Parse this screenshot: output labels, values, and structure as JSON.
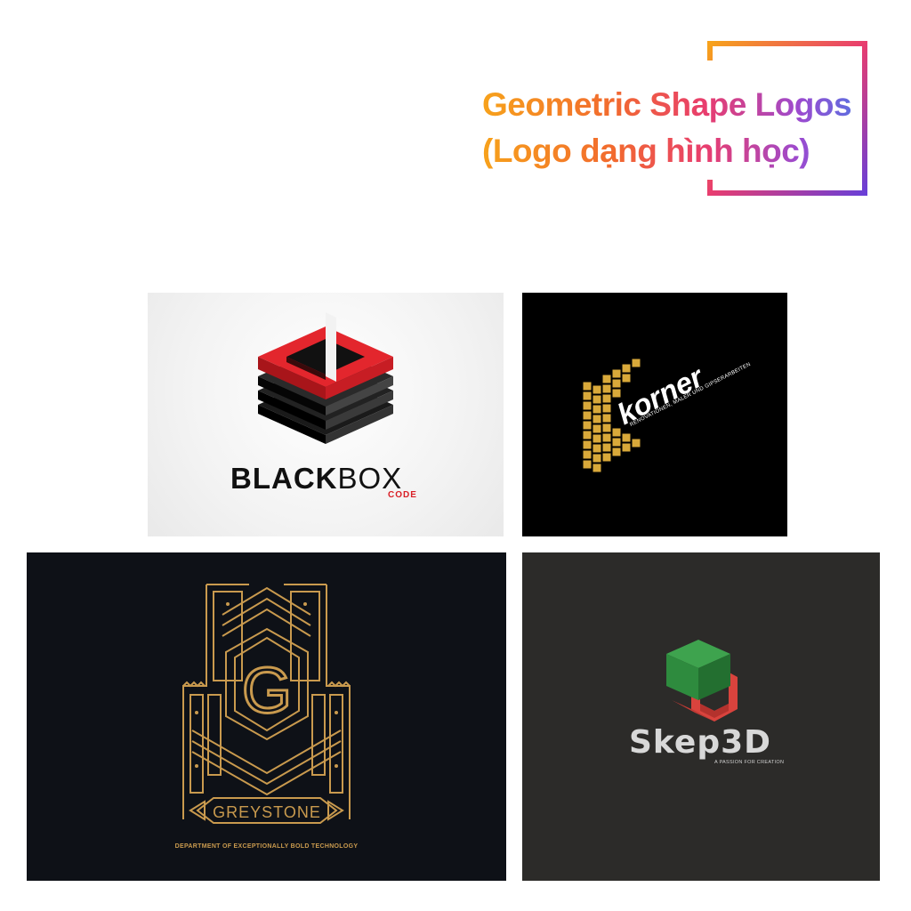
{
  "header": {
    "title_line1": "Geometric Shape Logos",
    "title_line2": "(Logo dạng hình học)"
  },
  "logos": [
    {
      "name": "BLACKBOX",
      "word_part1": "BLACK",
      "word_part2": "BOX",
      "sub": "CODE",
      "accent": "#d91e25"
    },
    {
      "name": "korner",
      "word": "korner",
      "sub": "RENOVATIONEN, MALER UND GIPSERARBEITEN",
      "accent": "#d9a93a"
    },
    {
      "name": "GREYSTONE",
      "word": "GREYSTONE",
      "letter": "G",
      "sub": "DEPARTMENT OF EXCEPTIONALLY BOLD TECHNOLOGY",
      "accent": "#c99a4e"
    },
    {
      "name": "Skep3D",
      "word": "Skep3D",
      "sub": "A PASSION FOR CREATION",
      "accent": "#2e8b3e",
      "accent2": "#d9433d"
    }
  ]
}
